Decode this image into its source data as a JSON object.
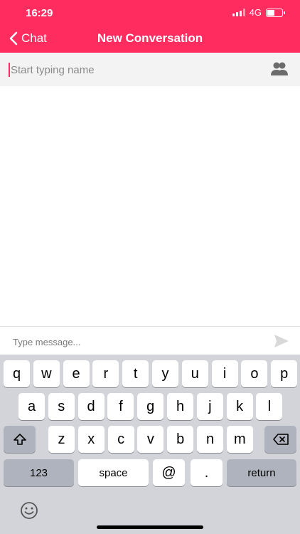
{
  "status_bar": {
    "time": "16:29",
    "network": "4G"
  },
  "header": {
    "back_label": "Chat",
    "title": "New Conversation"
  },
  "search": {
    "placeholder": "Start typing name"
  },
  "message_bar": {
    "placeholder": "Type message..."
  },
  "keyboard": {
    "row1": [
      "q",
      "w",
      "e",
      "r",
      "t",
      "y",
      "u",
      "i",
      "o",
      "p"
    ],
    "row2": [
      "a",
      "s",
      "d",
      "f",
      "g",
      "h",
      "j",
      "k",
      "l"
    ],
    "row3": [
      "z",
      "x",
      "c",
      "v",
      "b",
      "n",
      "m"
    ],
    "numbers_label": "123",
    "space_label": "space",
    "at_label": "@",
    "dot_label": ".",
    "return_label": "return"
  },
  "colors": {
    "accent": "#ff2d5f",
    "keyboard_bg": "#d2d4da"
  },
  "icons": [
    "chevron-left-icon",
    "contacts-icon",
    "send-icon",
    "shift-icon",
    "backspace-icon",
    "emoji-icon"
  ]
}
